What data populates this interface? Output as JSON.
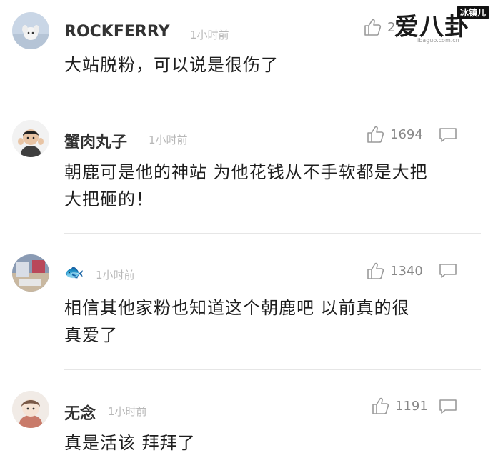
{
  "comments": [
    {
      "username": "ROCKFERRY",
      "time": "1小时前",
      "likes": "2",
      "lines": [
        "大站脱粉，可以说是很伤了"
      ],
      "avatar_icon": "white-dog-avatar-icon"
    },
    {
      "username": "蟹肉丸子",
      "time": "1小时前",
      "likes": "1694",
      "lines": [
        "朝鹿可是他的神站 为他花钱从不手软都是大把",
        "大把砸的！"
      ],
      "avatar_icon": "child-avatar-icon"
    },
    {
      "username": "🐟",
      "time": "1小时前",
      "likes": "1340",
      "lines": [
        "相信其他家粉也知道这个朝鹿吧  以前真的很",
        "真爱了"
      ],
      "avatar_icon": "photo-avatar-icon"
    },
    {
      "username": "无念",
      "time": "1小时前",
      "likes": "1191",
      "lines": [
        "真是活该 拜拜了"
      ],
      "avatar_icon": "doll-avatar-icon"
    }
  ],
  "watermark": {
    "brand": "爱八卦",
    "tag": "冰镇儿",
    "url": "ibaguo.com.cn"
  },
  "colors": {
    "text": "#1e1e1e",
    "secondary": "#888888",
    "time": "#b7b7b7",
    "divider": "#e6e6e6"
  }
}
